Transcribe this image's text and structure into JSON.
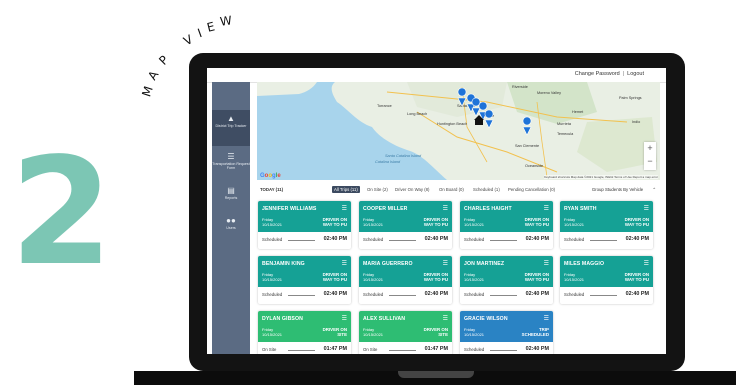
{
  "decor": {
    "step_number": "2",
    "caption_letters": [
      "M",
      "A",
      "P",
      "V",
      "I",
      "E",
      "W"
    ]
  },
  "header": {
    "change_password": "Change Password",
    "separator": "|",
    "logout": "Logout"
  },
  "sidebar": {
    "items": [
      {
        "label": "District Trip Tracker",
        "icon": "bus-icon",
        "active": true
      },
      {
        "label": "Transportation Request Form",
        "icon": "list-icon",
        "active": false
      },
      {
        "label": "Reports",
        "icon": "clipboard-icon",
        "active": false
      },
      {
        "label": "Users",
        "icon": "users-icon",
        "active": false
      }
    ]
  },
  "map": {
    "labels": [
      "Riverside",
      "Moreno Valley",
      "Santa Ana",
      "Long Beach",
      "Torrance",
      "Huntington Beach",
      "Irvine",
      "Temecula",
      "Hemet",
      "Murrieta",
      "Palm Springs",
      "Indio",
      "San Clemente",
      "Santa Catalina Island",
      "Catalina Island",
      "Oceanside"
    ],
    "google": [
      "G",
      "o",
      "o",
      "g",
      "l",
      "e"
    ],
    "attribution": "Keyboard shortcuts   Map data ©2021 Google, INEGI   Terms of Use   Report a map error",
    "zoom_in": "+",
    "zoom_out": "−",
    "colors": {
      "water": "#a8d4ec",
      "land": "#e9efe4",
      "park": "#c9dfbd",
      "pin": "#1e73d8"
    }
  },
  "filters": {
    "today_label": "TODAY (11)",
    "tabs": [
      {
        "label": "All Trips (11)",
        "active": true
      },
      {
        "label": "On Site (2)",
        "active": false
      },
      {
        "label": "Driver On Way (8)",
        "active": false
      },
      {
        "label": "On Board (0)",
        "active": false
      },
      {
        "label": "Scheduled (1)",
        "active": false
      },
      {
        "label": "Pending Cancellation (0)",
        "active": false
      }
    ],
    "group_label": "Group Students By Vehicle",
    "group_toggle": "⌃"
  },
  "cards": [
    {
      "name": "JENNIFER WILLIAMS",
      "day": "Friday",
      "date": "10/15/2021",
      "status1": "DRIVER ON",
      "status2": "WAY TO PU",
      "label": "Scheduled",
      "time": "02:40 PM",
      "color": "teal"
    },
    {
      "name": "COOPER MILLER",
      "day": "Friday",
      "date": "10/15/2021",
      "status1": "DRIVER ON",
      "status2": "WAY TO PU",
      "label": "Scheduled",
      "time": "02:40 PM",
      "color": "teal"
    },
    {
      "name": "CHARLES HAIGHT",
      "day": "Friday",
      "date": "10/15/2021",
      "status1": "DRIVER ON",
      "status2": "WAY TO PU",
      "label": "Scheduled",
      "time": "02:40 PM",
      "color": "teal"
    },
    {
      "name": "RYAN SMITH",
      "day": "Friday",
      "date": "10/15/2021",
      "status1": "DRIVER ON",
      "status2": "WAY TO PU",
      "label": "Scheduled",
      "time": "02:40 PM",
      "color": "teal"
    },
    {
      "name": "BENJAMIN KING",
      "day": "Friday",
      "date": "10/15/2021",
      "status1": "DRIVER ON",
      "status2": "WAY TO PU",
      "label": "Scheduled",
      "time": "02:40 PM",
      "color": "teal"
    },
    {
      "name": "MARIA GUERRERO",
      "day": "Friday",
      "date": "10/15/2021",
      "status1": "DRIVER ON",
      "status2": "WAY TO PU",
      "label": "Scheduled",
      "time": "02:40 PM",
      "color": "teal"
    },
    {
      "name": "JON MARTINEZ",
      "day": "Friday",
      "date": "10/15/2021",
      "status1": "DRIVER ON",
      "status2": "WAY TO PU",
      "label": "Scheduled",
      "time": "02:40 PM",
      "color": "teal"
    },
    {
      "name": "MILES MAGGIO",
      "day": "Friday",
      "date": "10/15/2021",
      "status1": "DRIVER ON",
      "status2": "WAY TO PU",
      "label": "Scheduled",
      "time": "02:40 PM",
      "color": "teal"
    },
    {
      "name": "DYLAN GIBSON",
      "day": "Friday",
      "date": "10/15/2021",
      "status1": "DRIVER ON",
      "status2": "SITE",
      "label": "On Site",
      "time": "01:47 PM",
      "color": "green"
    },
    {
      "name": "ALEX SULLIVAN",
      "day": "Friday",
      "date": "10/15/2021",
      "status1": "DRIVER ON",
      "status2": "SITE",
      "label": "On Site",
      "time": "01:47 PM",
      "color": "green"
    },
    {
      "name": "GRACIE WILSON",
      "day": "Friday",
      "date": "10/15/2021",
      "status1": "TRIP",
      "status2": "SCHEDULED",
      "label": "Scheduled",
      "time": "02:40 PM",
      "color": "blue"
    }
  ]
}
